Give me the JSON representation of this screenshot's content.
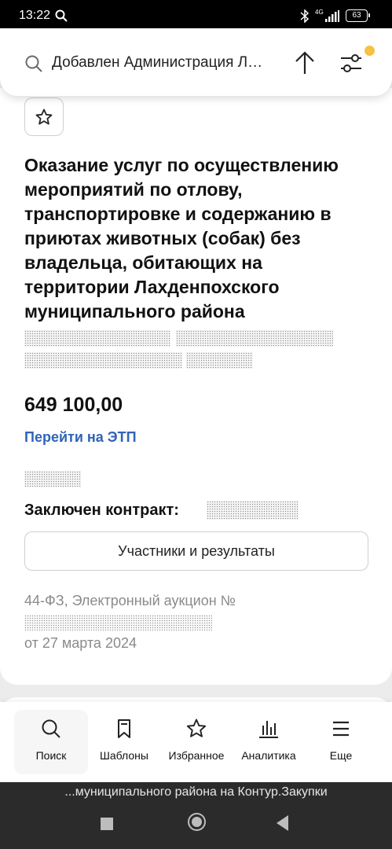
{
  "status_bar": {
    "time": "13:22",
    "network": "4G",
    "battery": "63"
  },
  "header": {
    "search_query": "Добавлен Администрация Лахденпохского муниципального района",
    "filter_dot_color": "#f5c242",
    "icons": [
      "search-icon",
      "sort-arrow-up-icon",
      "filter-sliders-icon"
    ]
  },
  "card": {
    "title": "Оказание услуг по осуществлению мероприятий по отлову, транспортировке и содержанию в приютах животных (собак) без владельца, обитающих на территории Лахденпохского муниципального района",
    "price": "649 100,00",
    "etp_link": "Перейти на ЭТП",
    "contract_label": "Заключен контракт:",
    "participants_button": "Участники и результаты",
    "procurement_type": "44-ФЗ, Электронный аукцион №",
    "procurement_date": "от 27 марта 2024",
    "link_color": "#2f64b7"
  },
  "bottom_nav": {
    "items": [
      {
        "label": "Поиск",
        "icon": "search-icon",
        "active": true
      },
      {
        "label": "Шаблоны",
        "icon": "bookmark-icon",
        "active": false
      },
      {
        "label": "Избранное",
        "icon": "star-icon",
        "active": false
      },
      {
        "label": "Аналитика",
        "icon": "chart-icon",
        "active": false
      },
      {
        "label": "Еще",
        "icon": "menu-icon",
        "active": false
      }
    ]
  },
  "caption": {
    "text": "...муниципального района на Контур.Закупки"
  }
}
